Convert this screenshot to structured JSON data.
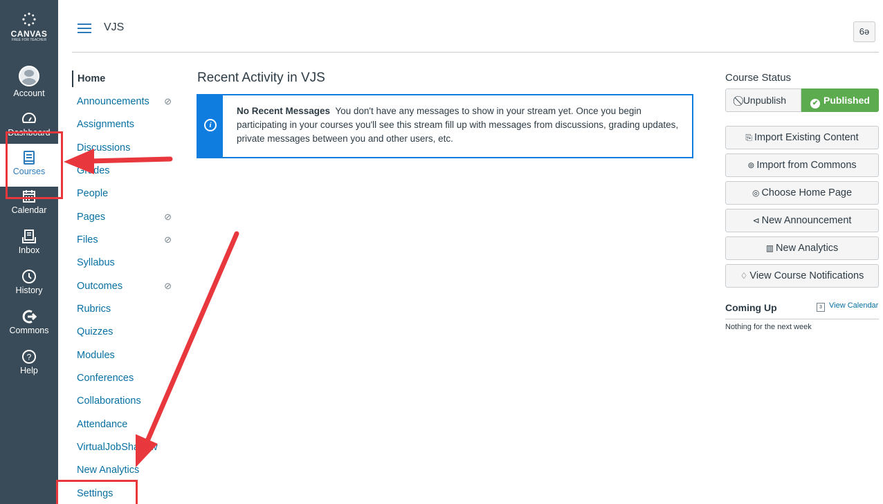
{
  "global_nav": {
    "logo": {
      "word": "CANVAS",
      "sub": "FREE FOR TEACHER"
    },
    "items": [
      {
        "label": "Account",
        "icon": "account-avatar"
      },
      {
        "label": "Dashboard",
        "icon": "dashboard-gauge-icon"
      },
      {
        "label": "Courses",
        "icon": "courses-book-icon",
        "active": true
      },
      {
        "label": "Calendar",
        "icon": "calendar-icon"
      },
      {
        "label": "Inbox",
        "icon": "inbox-icon"
      },
      {
        "label": "History",
        "icon": "history-clock-icon"
      },
      {
        "label": "Commons",
        "icon": "commons-arrow-icon"
      },
      {
        "label": "Help",
        "icon": "help-question-icon"
      }
    ]
  },
  "header": {
    "breadcrumb": "VJS",
    "immersive_glyph": "6ə"
  },
  "course_nav": {
    "items": [
      {
        "label": "Home",
        "active": true
      },
      {
        "label": "Announcements",
        "hidden": true
      },
      {
        "label": "Assignments"
      },
      {
        "label": "Discussions"
      },
      {
        "label": "Grades"
      },
      {
        "label": "People"
      },
      {
        "label": "Pages",
        "hidden": true
      },
      {
        "label": "Files",
        "hidden": true
      },
      {
        "label": "Syllabus"
      },
      {
        "label": "Outcomes",
        "hidden": true
      },
      {
        "label": "Rubrics"
      },
      {
        "label": "Quizzes"
      },
      {
        "label": "Modules"
      },
      {
        "label": "Conferences"
      },
      {
        "label": "Collaborations"
      },
      {
        "label": "Attendance"
      },
      {
        "label": "VirtualJobShadow"
      },
      {
        "label": "New Analytics"
      },
      {
        "label": "Settings"
      }
    ]
  },
  "main": {
    "title": "Recent Activity in VJS",
    "alert": {
      "heading": "No Recent Messages",
      "body": "You don't have any messages to show in your stream yet. Once you begin participating in your courses you'll see this stream fill up with messages from discussions, grading updates, private messages between you and other users, etc."
    }
  },
  "sidebar": {
    "status_title": "Course Status",
    "unpublish_label": "Unpublish",
    "published_label": "Published",
    "actions": [
      {
        "label": "Import Existing Content",
        "icon": "import-icon"
      },
      {
        "label": "Import from Commons",
        "icon": "commons-icon"
      },
      {
        "label": "Choose Home Page",
        "icon": "target-icon"
      },
      {
        "label": "New Announcement",
        "icon": "megaphone-icon"
      },
      {
        "label": "New Analytics",
        "icon": "analytics-icon"
      },
      {
        "label": "View Course Notifications",
        "icon": "bell-icon"
      }
    ],
    "coming_up": {
      "title": "Coming Up",
      "view_calendar": "View Calendar",
      "calendar_day": "3",
      "empty": "Nothing for the next week"
    }
  },
  "colors": {
    "nav_bg": "#394b58",
    "link": "#0770a3",
    "info": "#0e7ddf",
    "published": "#5cab4f",
    "annotation": "#e8383d"
  }
}
